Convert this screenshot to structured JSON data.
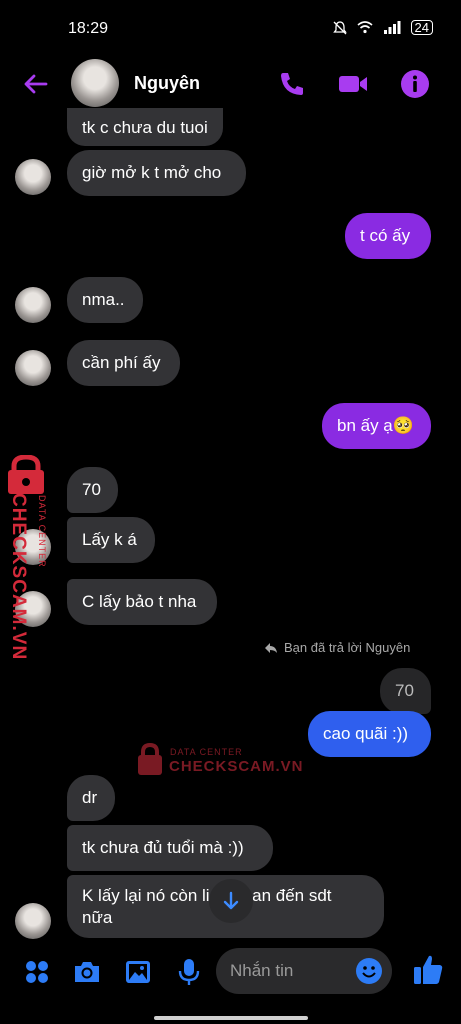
{
  "status_bar": {
    "time": "18:29",
    "battery": "24"
  },
  "header": {
    "contact_name": "Nguyên"
  },
  "messages": {
    "m0": "tk c chưa du tuoi",
    "m1": "giờ mở k t mở cho",
    "m2": "t có ấy",
    "m3": "nma..",
    "m4": "cần phí ấy",
    "m5": "bn ấy ạ🥺",
    "m6": "70",
    "m7": "Lấy k á",
    "m8": "C lấy bảo t nha",
    "reply_note": "Bạn đã trả lời Nguyên",
    "quoted": "70",
    "m9": "cao quãi :))",
    "m10": "dr",
    "m11": "tk chưa đủ tuổi mà :))",
    "m12_line1": "K lấy lại nó còn liên quan đến sdt",
    "m12_line2": "nữa"
  },
  "watermark": {
    "side_top": "DATA CENTER",
    "side_main": "CHECKSCAM.VN",
    "center_top": "DATA CENTER",
    "center_main": "CHECKSCAM.VN"
  },
  "composer": {
    "placeholder": "Nhắn tin"
  },
  "colors": {
    "accent": "#8a2be2",
    "sent_blue": "#2f5fee",
    "received": "#333336",
    "icon_blue": "#2d7cf6"
  }
}
